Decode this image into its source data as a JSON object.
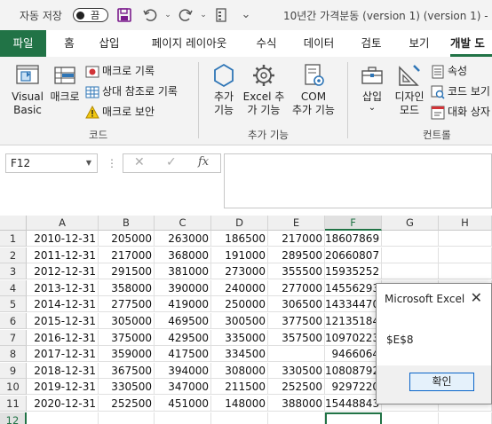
{
  "titlebar": {
    "autosave_label": "자동 저장",
    "toggle_label": "끔",
    "title": "10년간 가격분동 (version 1) (version 1)  -"
  },
  "tabs": {
    "file": "파일",
    "home": "홈",
    "insert": "삽입",
    "page_layout": "페이지 레이아웃",
    "formulas": "수식",
    "data": "데이터",
    "review": "검토",
    "view": "보기",
    "developer": "개발 도"
  },
  "ribbon": {
    "code": {
      "visual_basic_line1": "Visual",
      "visual_basic_line2": "Basic",
      "macros": "매크로",
      "record_macro": "매크로 기록",
      "relative_ref": "상대 참조로 기록",
      "macro_security": "매크로 보안",
      "label": "코드"
    },
    "addins": {
      "addins_line1": "추가",
      "addins_line2": "기능",
      "excel_addins_line1": "Excel 추",
      "excel_addins_line2": "가 기능",
      "com_addins_line1": "COM",
      "com_addins_line2": "추가 기능",
      "label": "추가 기능"
    },
    "controls": {
      "insert": "삽입",
      "insert_arrow": "⌄",
      "design_mode_line1": "디자인",
      "design_mode_line2": "모드",
      "properties": "속성",
      "view_code": "코드 보기",
      "run_dialog": "대화 상자",
      "label": "컨트롤"
    }
  },
  "formula_bar": {
    "name_box": "F12",
    "dots": "⋮",
    "cancel_icon": "✕",
    "enter_icon": "✓",
    "fx_icon": "fx",
    "value": ""
  },
  "sheet": {
    "columns": [
      "A",
      "B",
      "C",
      "D",
      "E",
      "F",
      "G",
      "H"
    ],
    "selected_column": "F",
    "selected_row": "12",
    "rows": [
      {
        "num": "1",
        "cells": [
          "2010-12-31",
          "205000",
          "263000",
          "186500",
          "217000",
          "18607869"
        ]
      },
      {
        "num": "2",
        "cells": [
          "2011-12-31",
          "217000",
          "368000",
          "191000",
          "289500",
          "20660807"
        ]
      },
      {
        "num": "3",
        "cells": [
          "2012-12-31",
          "291500",
          "381000",
          "273000",
          "355500",
          "15935252"
        ]
      },
      {
        "num": "4",
        "cells": [
          "2013-12-31",
          "358000",
          "390000",
          "240000",
          "277000",
          "14556293"
        ]
      },
      {
        "num": "5",
        "cells": [
          "2014-12-31",
          "277500",
          "419000",
          "250000",
          "306500",
          "14334470"
        ]
      },
      {
        "num": "6",
        "cells": [
          "2015-12-31",
          "305000",
          "469500",
          "300500",
          "377500",
          "12135184"
        ]
      },
      {
        "num": "7",
        "cells": [
          "2016-12-31",
          "375000",
          "429500",
          "335000",
          "357500",
          "10970223"
        ]
      },
      {
        "num": "8",
        "cells": [
          "2017-12-31",
          "359000",
          "417500",
          "334500",
          "",
          "9466064"
        ]
      },
      {
        "num": "9",
        "cells": [
          "2018-12-31",
          "367500",
          "394000",
          "308000",
          "330500",
          "10808792"
        ]
      },
      {
        "num": "10",
        "cells": [
          "2019-12-31",
          "330500",
          "347000",
          "211500",
          "252500",
          "9297220"
        ]
      },
      {
        "num": "11",
        "cells": [
          "2020-12-31",
          "252500",
          "451000",
          "148000",
          "388000",
          "15448843"
        ]
      },
      {
        "num": "12",
        "cells": [
          "",
          "",
          "",
          "",
          "",
          ""
        ]
      }
    ]
  },
  "dialog": {
    "title": "Microsoft Excel",
    "close": "✕",
    "message": "$E$8",
    "ok_label": "확인"
  },
  "colors": {
    "accent": "#217346",
    "dialog_button_border": "#0a64c8"
  }
}
